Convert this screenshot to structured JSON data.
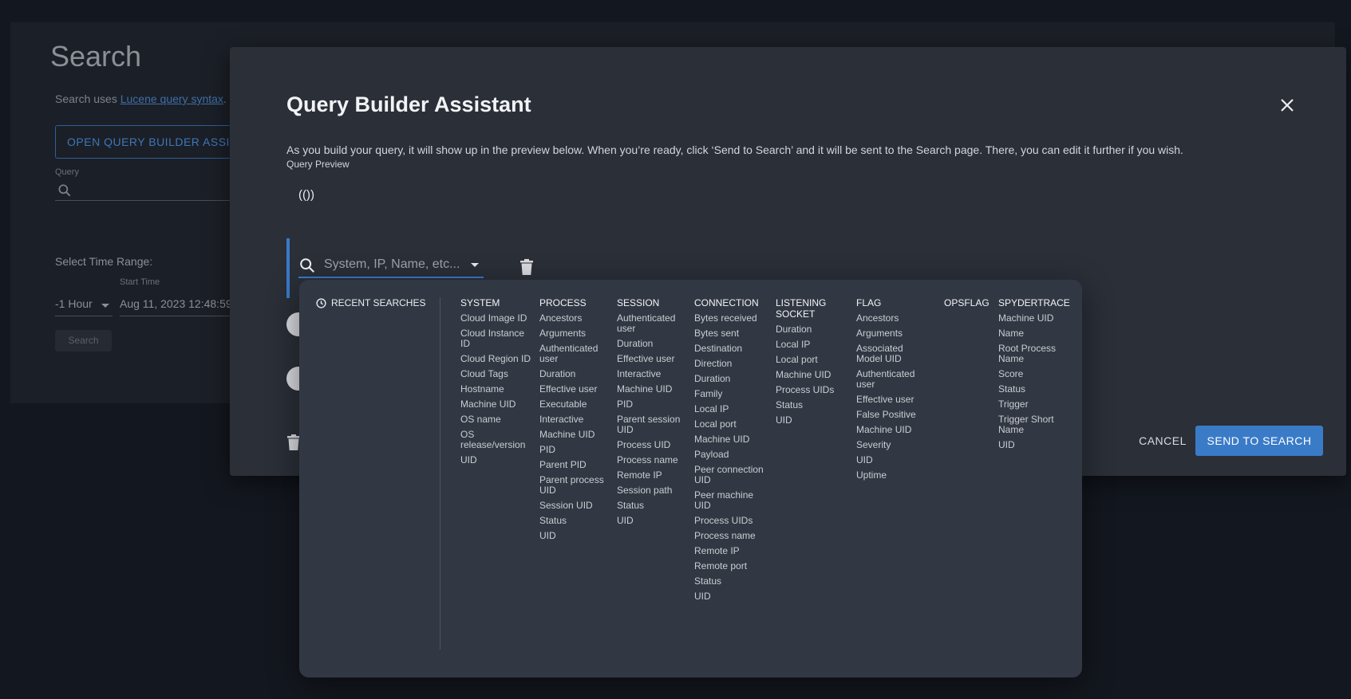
{
  "background": {
    "title": "Search",
    "hint_prefix": "Search uses ",
    "hint_link": "Lucene query syntax",
    "hint_suffix": ".",
    "open_builder_label": "OPEN QUERY BUILDER ASSISTANT",
    "query_label": "Query",
    "time_range_label": "Select Time Range:",
    "time_range_value": "-1 Hour",
    "start_time_label": "Start Time",
    "start_time_value": "Aug 11, 2023 12:48:59",
    "search_button": "Search"
  },
  "dialog": {
    "title": "Query Builder Assistant",
    "description": "As you build your query, it will show up in the preview below. When you’re ready, click ‘Send to Search’ and it will be sent to the Search page. There, you can edit it further if you wish.",
    "preview_label": "Query Preview",
    "preview_value": "(())",
    "search_placeholder": "System, IP, Name, etc...",
    "cancel_label": "CANCEL",
    "send_label": "SEND TO SEARCH"
  },
  "dropdown": {
    "recent_label": "RECENT SEARCHES",
    "columns": [
      {
        "head": "SYSTEM",
        "items": [
          "Cloud Image ID",
          "Cloud Instance ID",
          "Cloud Region ID",
          "Cloud Tags",
          "Hostname",
          "Machine UID",
          "OS name",
          "OS release/version",
          "UID"
        ]
      },
      {
        "head": "PROCESS",
        "items": [
          "Ancestors",
          "Arguments",
          "Authenticated user",
          "Duration",
          "Effective user",
          "Executable",
          "Interactive",
          "Machine UID",
          "PID",
          "Parent PID",
          "Parent process UID",
          "Session UID",
          "Status",
          "UID"
        ]
      },
      {
        "head": "SESSION",
        "items": [
          "Authenticated user",
          "Duration",
          "Effective user",
          "Interactive",
          "Machine UID",
          "PID",
          "Parent session UID",
          "Process UID",
          "Process name",
          "Remote IP",
          "Session path",
          "Status",
          "UID"
        ]
      },
      {
        "head": "CONNECTION",
        "items": [
          "Bytes received",
          "Bytes sent",
          "Destination",
          "Direction",
          "Duration",
          "Family",
          "Local IP",
          "Local port",
          "Machine UID",
          "Payload",
          "Peer connection UID",
          "Peer machine UID",
          "Process UIDs",
          "Process name",
          "Remote IP",
          "Remote port",
          "Status",
          "UID"
        ]
      },
      {
        "head": "LISTENING SOCKET",
        "items": [
          "Duration",
          "Local IP",
          "Local port",
          "Machine UID",
          "Process UIDs",
          "Status",
          "UID"
        ]
      },
      {
        "head": "FLAG",
        "items": [
          "Ancestors",
          "Arguments",
          "Associated Model UID",
          "Authenticated user",
          "Effective user",
          "False Positive",
          "Machine UID",
          "Severity",
          "UID",
          "Uptime"
        ]
      },
      {
        "head": "OPSFLAG",
        "items": []
      },
      {
        "head": "SPYDERTRACE",
        "items": [
          "Machine UID",
          "Name",
          "Root Process Name",
          "Score",
          "Status",
          "Trigger",
          "Trigger Short Name",
          "UID"
        ]
      }
    ]
  }
}
